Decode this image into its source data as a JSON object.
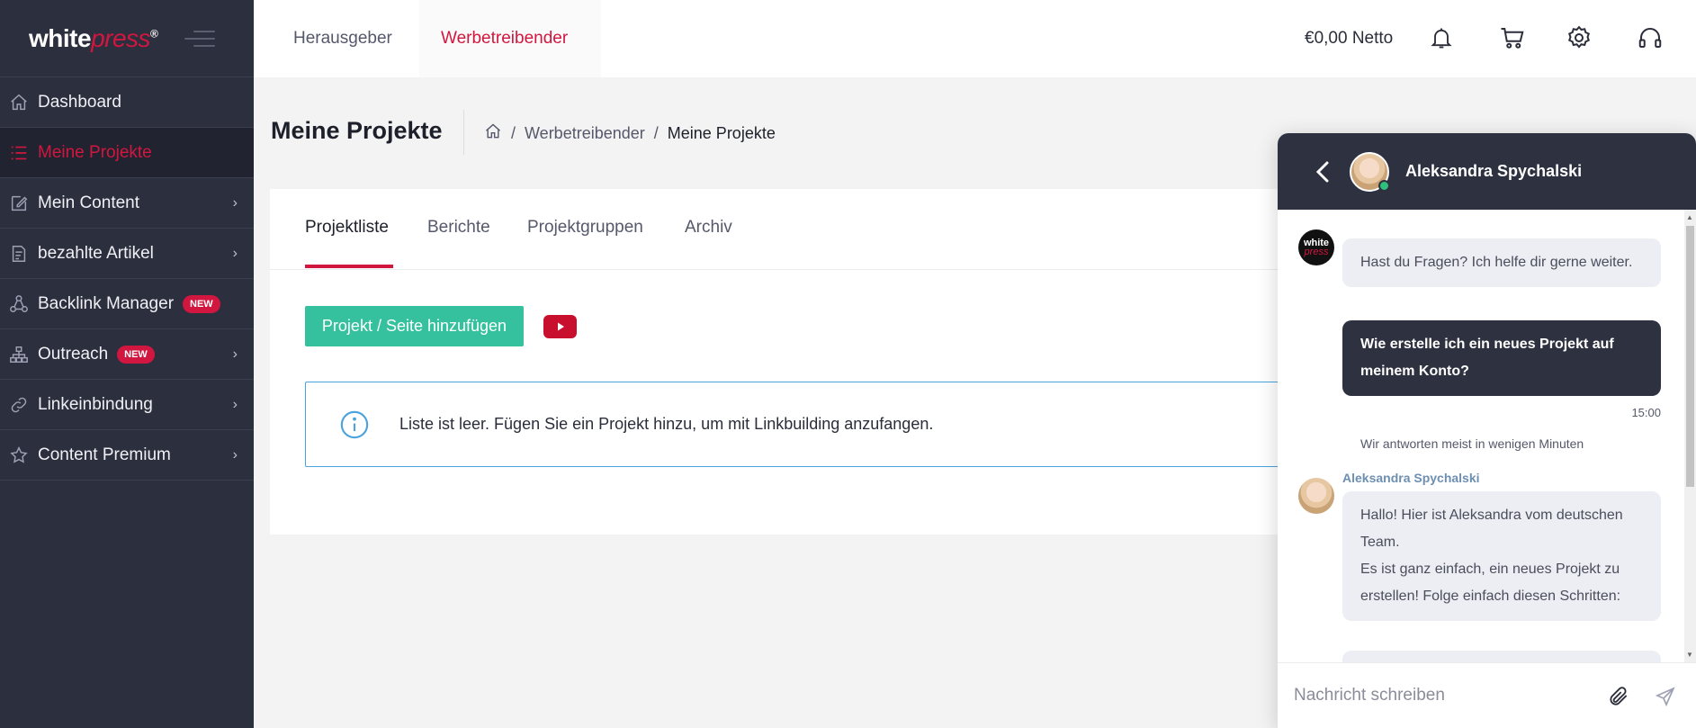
{
  "sidebar": {
    "logo_white": "white",
    "logo_press": "press",
    "logo_reg": "®",
    "items": [
      {
        "label": "Dashboard",
        "icon": "home-icon"
      },
      {
        "label": "Meine Projekte",
        "icon": "list-icon",
        "active": true
      },
      {
        "label": "Mein Content",
        "icon": "edit-icon"
      },
      {
        "label": "bezahlte Artikel",
        "icon": "invoice-icon"
      },
      {
        "label": "Backlink Manager",
        "icon": "network-icon",
        "badge": "NEW"
      },
      {
        "label": "Outreach",
        "icon": "sitemap-icon",
        "badge": "NEW"
      },
      {
        "label": "Linkeinbindung",
        "icon": "link-icon"
      },
      {
        "label": "Content Premium",
        "icon": "star-icon"
      }
    ]
  },
  "header": {
    "tab_publisher": "Herausgeber",
    "tab_advertiser": "Werbetreibender",
    "balance": "€0,00 Netto",
    "icons": [
      "bell-icon",
      "cart-icon",
      "gear-icon",
      "headset-icon"
    ]
  },
  "page": {
    "title": "Meine Projekte",
    "breadcrumb": [
      "Werbetreibender",
      "Meine Projekte"
    ]
  },
  "card": {
    "tabs": [
      "Projektliste",
      "Berichte",
      "Projektgruppen",
      "Archiv"
    ],
    "active_tab": "Projektliste",
    "add_button": "Projekt / Seite hinzufügen",
    "info_text": "Liste ist leer. Fügen Sie ein Projekt hinzu, um mit Linkbuilding anzufangen."
  },
  "chat": {
    "agent_name": "Aleksandra Spychalski",
    "bot_logo_top": "white",
    "bot_logo_bottom": "press",
    "msg1": "Hast du Fragen? Ich helfe dir gerne weiter.",
    "msg2": "Wie erstelle ich ein neues Projekt auf meinem Konto?",
    "time": "15:00",
    "reply_note": "Wir antworten meist in wenigen Minuten",
    "agent_label": "Aleksandra Spychalski",
    "msg3": "Hallo! Hier ist Aleksandra vom deutschen Team.\nEs ist ganz einfach, ein neues Projekt zu erstellen! Folge einfach diesen Schritten:",
    "input_placeholder": "Nachricht schreiben"
  },
  "colors": {
    "brand": "#d1173f",
    "sidebar_bg": "#2c2f3e",
    "button_green": "#35c19d",
    "info_blue": "#4ba3dd"
  }
}
